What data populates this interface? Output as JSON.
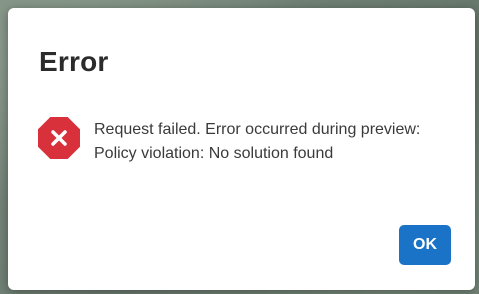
{
  "dialog": {
    "title": "Error",
    "icon": "error-octagon-icon",
    "message": "Request failed. Error occurred during preview: Policy violation: No solution found",
    "ok_label": "OK"
  },
  "colors": {
    "error_icon": "#d8313c",
    "primary_button": "#1a73c7",
    "title_text": "#2b2b2b"
  }
}
